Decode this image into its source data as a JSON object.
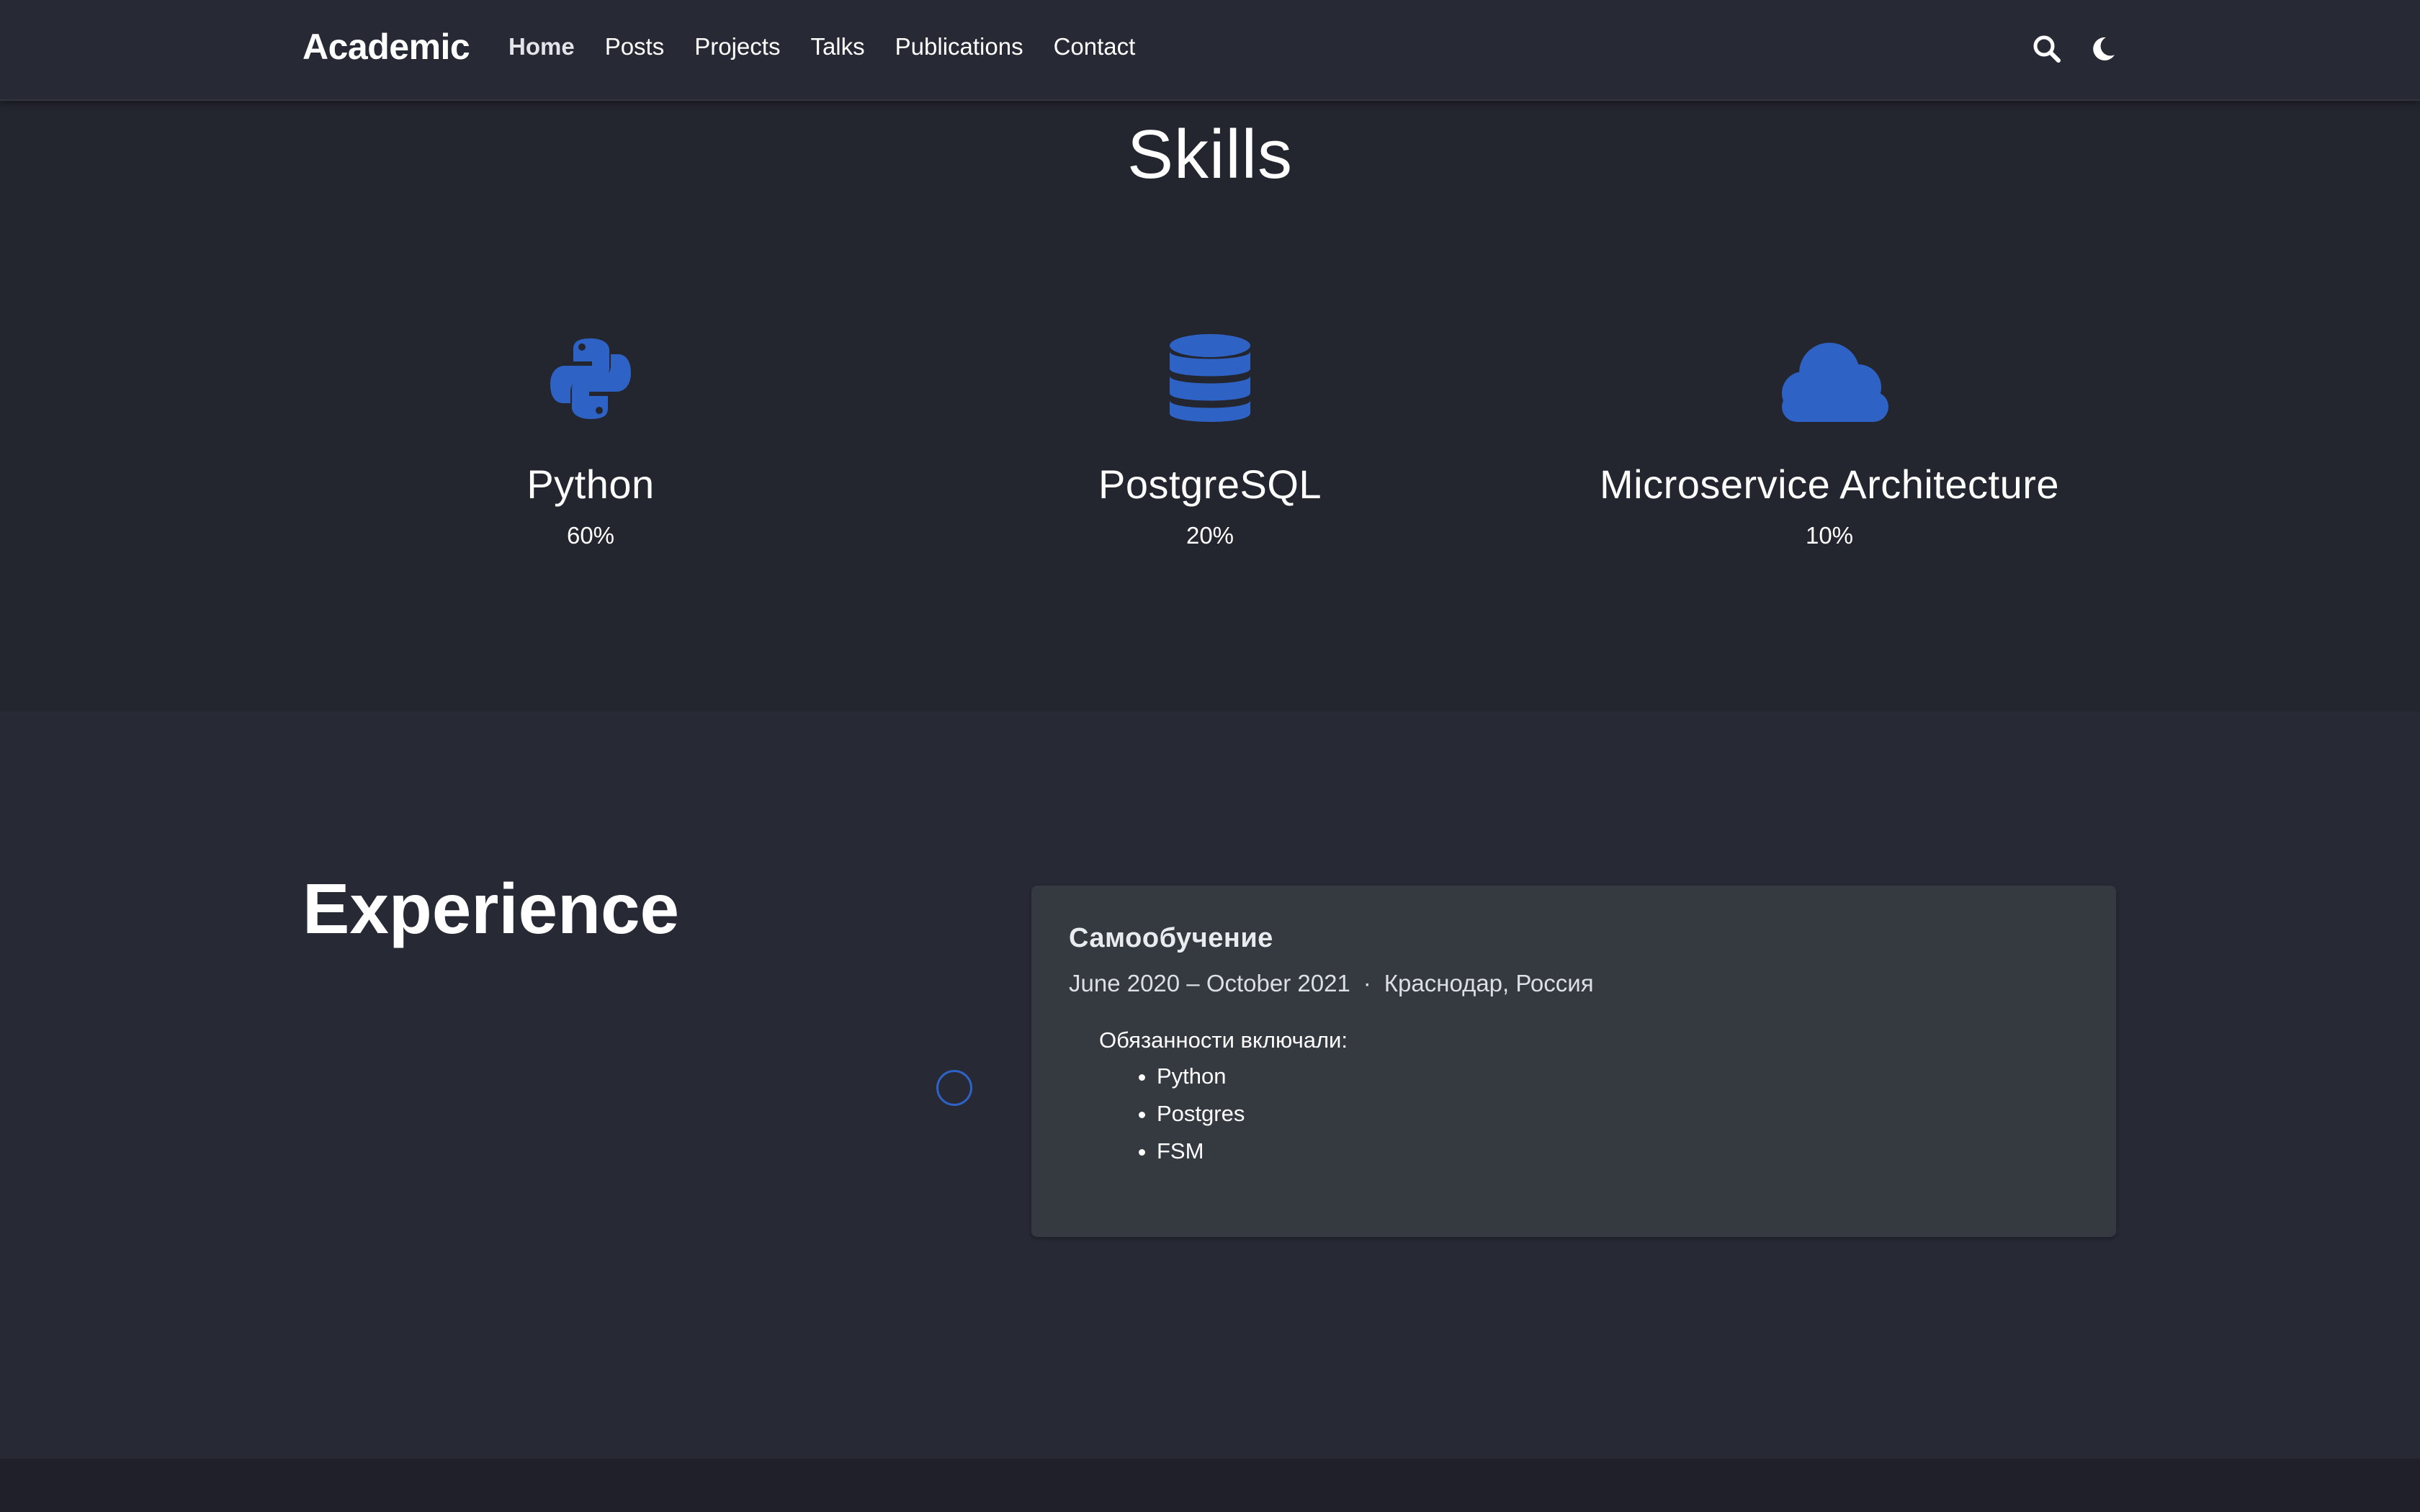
{
  "navbar": {
    "brand": "Academic",
    "links": [
      {
        "label": "Home",
        "active": true
      },
      {
        "label": "Posts"
      },
      {
        "label": "Projects"
      },
      {
        "label": "Talks"
      },
      {
        "label": "Publications"
      },
      {
        "label": "Contact"
      }
    ],
    "icons": [
      "search-icon",
      "moon-icon"
    ]
  },
  "skills": {
    "title": "Skills",
    "items": [
      {
        "name": "Python",
        "percent": "60%",
        "icon": "python-icon"
      },
      {
        "name": "PostgreSQL",
        "percent": "20%",
        "icon": "database-icon"
      },
      {
        "name": "Microservice Architecture",
        "percent": "10%",
        "icon": "cloud-icon"
      }
    ]
  },
  "experience": {
    "title": "Experience",
    "entries": [
      {
        "title": "Самообучение",
        "dates": "June 2020 – October 2021",
        "separator": "·",
        "location": "Краснодар, Россия",
        "intro": "Обязанности включали:",
        "bullets": [
          "Python",
          "Postgres",
          "FSM"
        ]
      }
    ]
  },
  "colors": {
    "accent": "#2e62c4",
    "navbar_bg": "#272935",
    "skills_bg": "#23252f",
    "experience_bg": "#272935",
    "card_bg": "#343a40"
  }
}
